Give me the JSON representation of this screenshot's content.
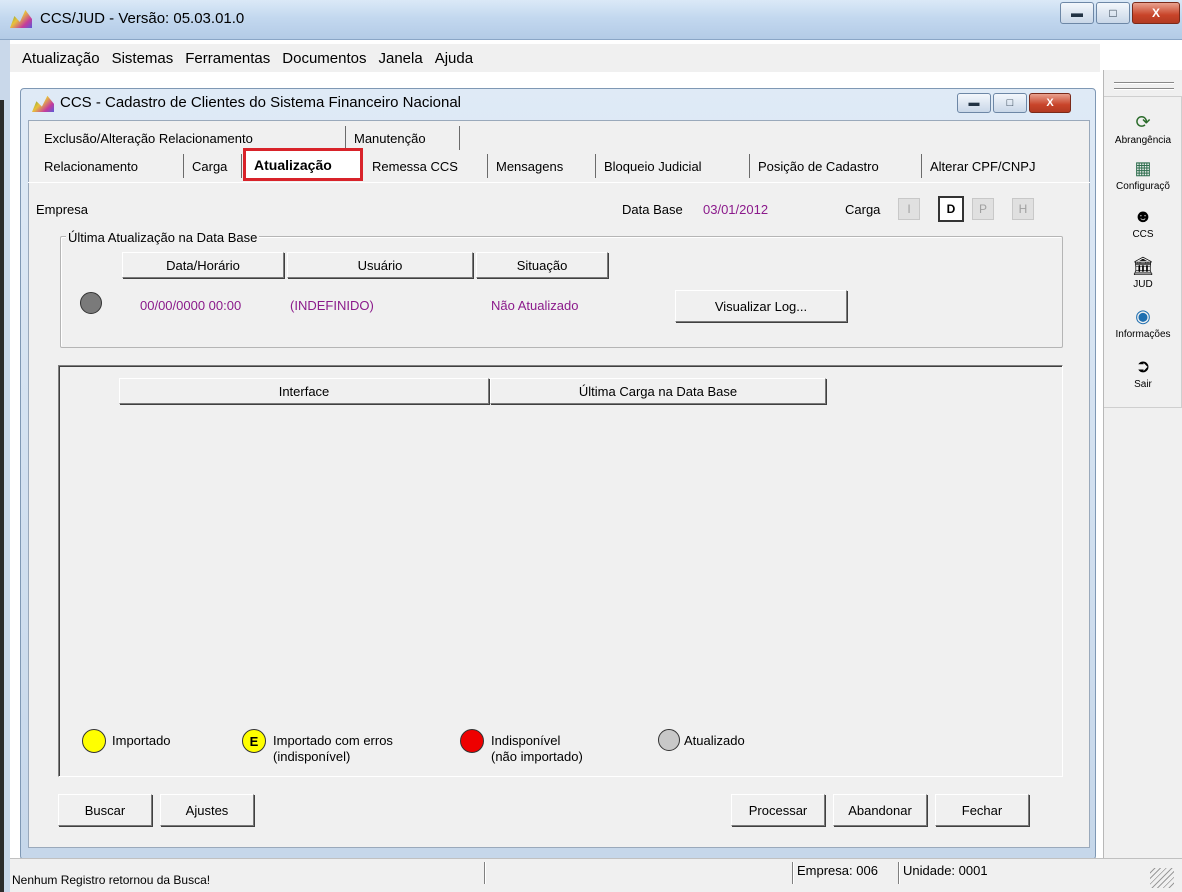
{
  "app": {
    "title": "CCS/JUD - Versão: 05.03.01.0",
    "menu": [
      "Atualização",
      "Sistemas",
      "Ferramentas",
      "Documentos",
      "Janela",
      "Ajuda"
    ]
  },
  "toolbar": [
    {
      "label": "Abrangência",
      "icon": "refresh-globe-icon"
    },
    {
      "label": "Configuraçõ",
      "icon": "settings-grid-icon"
    },
    {
      "label": "CCS",
      "icon": "person-icon"
    },
    {
      "label": "JUD",
      "icon": "courthouse-icon"
    },
    {
      "label": "Informações",
      "icon": "globe-info-icon"
    },
    {
      "label": "Sair",
      "icon": "exit-door-icon"
    }
  ],
  "child": {
    "title": "CCS - Cadastro de Clientes do Sistema Financeiro Nacional",
    "tabs_row1": [
      "Exclusão/Alteração Relacionamento",
      "Manutenção"
    ],
    "tabs_row2": [
      "Relacionamento",
      "Carga",
      "Atualização",
      "Remessa CCS",
      "Mensagens",
      "Bloqueio Judicial",
      "Posição de Cadastro",
      "Alterar CPF/CNPJ"
    ],
    "active_tab": "Atualização",
    "empresa_label": "Empresa",
    "data_base_label": "Data Base",
    "data_base_value": "03/01/2012",
    "carga_label": "Carga",
    "carga_buttons": [
      "I",
      "D",
      "P",
      "H"
    ],
    "group": {
      "title": "Última Atualização na Data Base",
      "headers": [
        "Data/Horário",
        "Usuário",
        "Situação"
      ],
      "datetime": "00/00/0000 00:00",
      "user": "(INDEFINIDO)",
      "status": "Não Atualizado",
      "view_log": "Visualizar Log..."
    },
    "grid": {
      "headers": [
        "Interface",
        "Última Carga na Data Base"
      ]
    },
    "legend": [
      {
        "color": "#ffff00",
        "mark": "",
        "line1": "Importado",
        "line2": ""
      },
      {
        "color": "#ffff00",
        "mark": "E",
        "line1": "Importado com erros",
        "line2": "(indisponível)"
      },
      {
        "color": "#ee0000",
        "mark": "",
        "line1": "Indisponível",
        "line2": "(não importado)"
      },
      {
        "color": "#c8c8c8",
        "mark": "",
        "line1": "Atualizado",
        "line2": ""
      }
    ],
    "buttons": {
      "buscar": "Buscar",
      "ajustes": "Ajustes",
      "processar": "Processar",
      "abandonar": "Abandonar",
      "fechar": "Fechar"
    }
  },
  "statusbar": {
    "message": "Nenhum Registro retornou da Busca!",
    "empresa": "Empresa: 006",
    "unidade": "Unidade: 0001"
  }
}
